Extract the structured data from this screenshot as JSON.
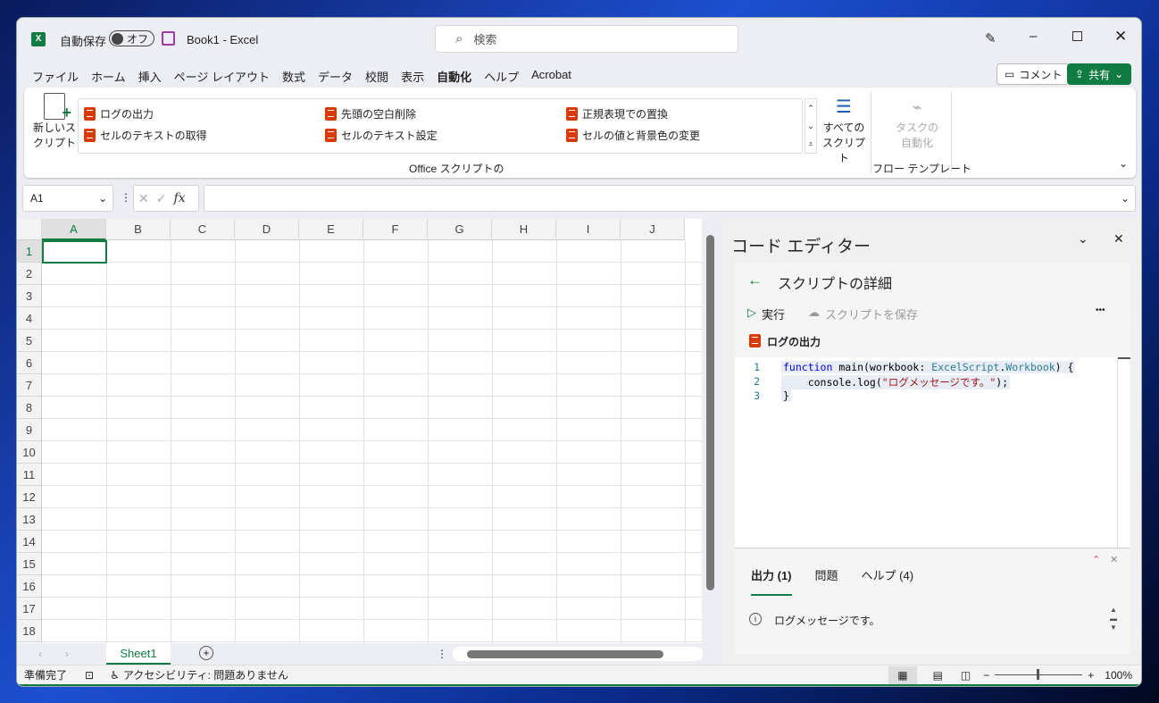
{
  "title": {
    "autosave_label": "自動保存",
    "autosave_state": "オフ",
    "doc_title": "Book1  -  Excel",
    "search_placeholder": "検索"
  },
  "tabs": [
    "ファイル",
    "ホーム",
    "挿入",
    "ページ レイアウト",
    "数式",
    "データ",
    "校閲",
    "表示",
    "自動化",
    "ヘルプ",
    "Acrobat"
  ],
  "active_tab": "自動化",
  "header_buttons": {
    "comment": "コメント",
    "share": "共有"
  },
  "ribbon": {
    "new_script": [
      "新しいス",
      "クリプト"
    ],
    "scripts": [
      "ログの出力",
      "セルのテキストの取得",
      "先頭の空白削除",
      "セルのテキスト設定",
      "正規表現での置換",
      "セルの値と背景色の変更"
    ],
    "all_scripts": [
      "すべての",
      "スクリプト"
    ],
    "group_label": "Office スクリプトの",
    "task_auto": [
      "タスクの",
      "自動化"
    ],
    "flow_label": "フロー テンプレート"
  },
  "formula": {
    "name_box": "A1",
    "fx": "fx",
    "value": ""
  },
  "columns": [
    "A",
    "B",
    "C",
    "D",
    "E",
    "F",
    "G",
    "H",
    "I",
    "J"
  ],
  "rows": [
    "1",
    "2",
    "3",
    "4",
    "5",
    "6",
    "7",
    "8",
    "9",
    "10",
    "11",
    "12",
    "13",
    "14",
    "15",
    "16",
    "17",
    "18"
  ],
  "sheet_tab": "Sheet1",
  "editor": {
    "title": "コード エディター",
    "subtitle": "スクリプトの詳細",
    "run": "実行",
    "save": "スクリプトを保存",
    "more": "•••",
    "script_name": "ログの出力",
    "code": [
      {
        "n": "1",
        "parts": [
          [
            "function",
            "kw"
          ],
          [
            " main(workbook: ",
            ""
          ],
          [
            "ExcelScript",
            "ty"
          ],
          [
            ".",
            ""
          ],
          [
            "Workbook",
            "ty"
          ],
          [
            ") {",
            ""
          ]
        ]
      },
      {
        "n": "2",
        "parts": [
          [
            "    console.log(",
            ""
          ],
          [
            "\"ログメッセージです。\"",
            "str"
          ],
          [
            ");",
            ""
          ]
        ]
      },
      {
        "n": "3",
        "parts": [
          [
            "}",
            ""
          ]
        ]
      }
    ],
    "out_tabs": [
      "出力 (1)",
      "問題",
      "ヘルプ (4)"
    ],
    "output_msg": "ログメッセージです。"
  },
  "status": {
    "ready": "準備完了",
    "accessibility": "アクセシビリティ: 問題ありません",
    "zoom": "100%",
    "zoom_minus": "−",
    "zoom_plus": "+"
  },
  "colors": {
    "accent": "#107c41",
    "script_icon": "#d83b01"
  }
}
